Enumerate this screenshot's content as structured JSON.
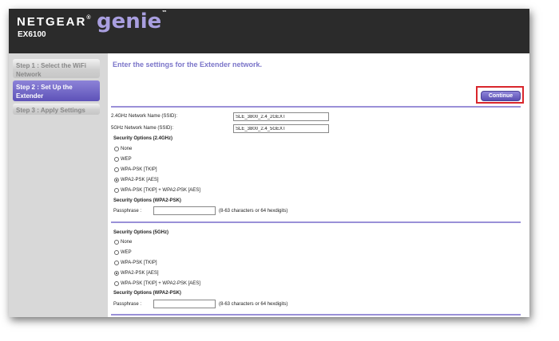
{
  "header": {
    "brand": "NETGEAR",
    "brand_mark": "®",
    "product": "genie",
    "product_mark": "™",
    "model": "EX6100"
  },
  "sidebar": {
    "steps": [
      {
        "label": "Step 1 : Select the WiFi Network",
        "state": "inactive"
      },
      {
        "label": "Step 2 : Set Up the Extender",
        "state": "active"
      },
      {
        "label": "Step 3 : Apply Settings",
        "state": "inactive"
      }
    ]
  },
  "main": {
    "intro": "Enter the settings for the Extender network.",
    "continue_label": "Continue",
    "ssid_24_label": "2.4GHz Network Name (SSID):",
    "ssid_24_value": "SLE_3800_2.4_2GEXT",
    "ssid_5_label": "5GHz Network Name (SSID):",
    "ssid_5_value": "SLE_3800_2.4_5GEXT",
    "security_24": {
      "heading": "Security Options (2.4GHz)",
      "options": [
        "None",
        "WEP",
        "WPA-PSK [TKIP]",
        "WPA2-PSK [AES]",
        "WPA-PSK [TKIP] + WPA2-PSK [AES]"
      ],
      "selected": "WPA2-PSK [AES]",
      "sub_heading": "Security Options (WPA2-PSK)",
      "passphrase_label": "Passphrase :",
      "passphrase_value": "",
      "passphrase_hint": "(8-63 characters or 64 hexdigits)"
    },
    "security_5": {
      "heading": "Security Options (5GHz)",
      "options": [
        "None",
        "WEP",
        "WPA-PSK [TKIP]",
        "WPA2-PSK [AES]",
        "WPA-PSK [TKIP] + WPA2-PSK [AES]"
      ],
      "selected": "WPA2-PSK [AES]",
      "sub_heading": "Security Options (WPA2-PSK)",
      "passphrase_label": "Passphrase :",
      "passphrase_value": "",
      "passphrase_hint": "(8-63 characters or 64 hexdigits)"
    }
  },
  "colors": {
    "accent": "#7b75c9",
    "header_bg": "#2b2b2b",
    "active_step": "#6b61c4",
    "highlight": "#d9262c"
  }
}
